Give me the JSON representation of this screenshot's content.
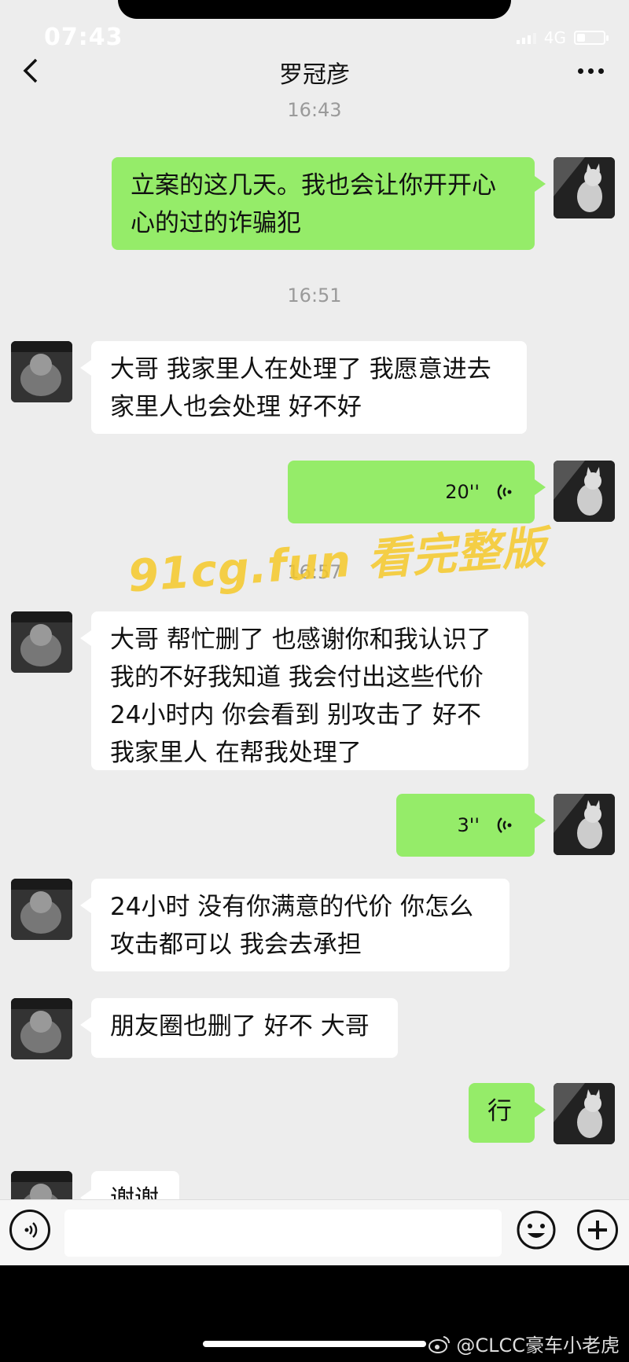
{
  "status_bar": {
    "time": "07:43",
    "network": "4G",
    "battery_level": 0.3
  },
  "header": {
    "title": "罗冠彦",
    "back_icon": "chevron-left-icon",
    "more_icon": "more-dots-icon"
  },
  "timestamps": [
    "16:43",
    "16:51",
    "16:57"
  ],
  "messages": [
    {
      "sender": "me",
      "type": "text",
      "lines": [
        "立案的这几天。我也会让你开开心",
        "心的过的诈骗犯"
      ]
    },
    {
      "sender": "other",
      "type": "text",
      "lines": [
        "大哥 我家里人在处理了 我愿意进去",
        "家里人也会处理 好不好"
      ]
    },
    {
      "sender": "me",
      "type": "voice",
      "duration": "20''"
    },
    {
      "sender": "other",
      "type": "text",
      "lines": [
        "大哥 帮忙删了 也感谢你和我认识了",
        "我的不好我知道 我会付出这些代价",
        "24小时内 你会看到 别攻击了 好不",
        "我家里人 在帮我处理了"
      ]
    },
    {
      "sender": "me",
      "type": "voice",
      "duration": "3''"
    },
    {
      "sender": "other",
      "type": "text",
      "lines": [
        "24小时 没有你满意的代价 你怎么",
        "攻击都可以 我会去承担"
      ]
    },
    {
      "sender": "other",
      "type": "text",
      "lines": [
        "朋友圈也删了 好不 大哥"
      ]
    },
    {
      "sender": "me",
      "type": "text",
      "lines": [
        "行"
      ]
    },
    {
      "sender": "other",
      "type": "text",
      "lines": [
        "谢谢"
      ]
    }
  ],
  "watermark": "91cg.fun 看完整版",
  "input_bar": {
    "placeholder": "",
    "voice_icon": "voice-toggle-icon",
    "emoji_icon": "emoji-icon",
    "plus_icon": "plus-icon"
  },
  "credit": "@CLCC豪车小老虎",
  "colors": {
    "green_bubble": "#95ec69",
    "white_bubble": "#ffffff",
    "background": "#ededed",
    "watermark": "#f5c828"
  }
}
